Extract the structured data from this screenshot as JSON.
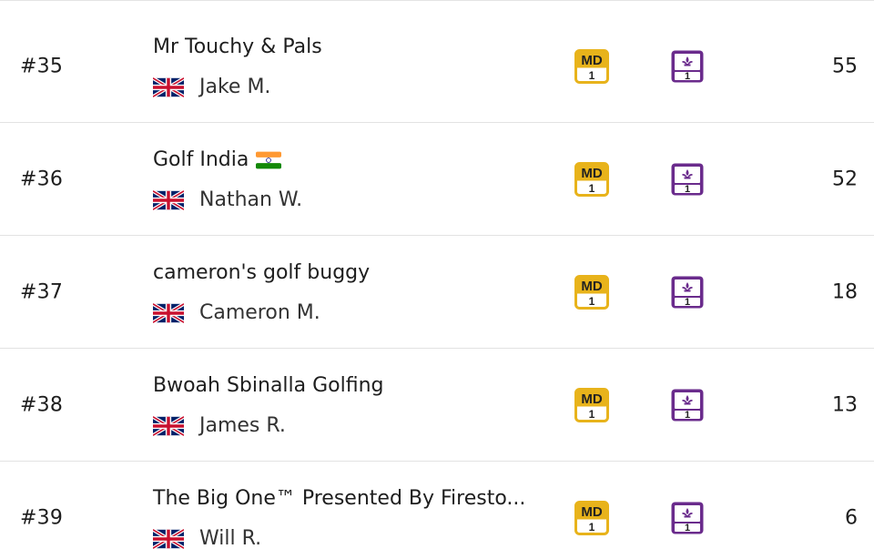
{
  "colors": {
    "md_chip": "#e8b31b",
    "gw_chip": "#6a2b8c",
    "divider": "#e2e2e2",
    "text": "#1e1e1e"
  },
  "chips": {
    "md": {
      "code": "MD",
      "number": "1"
    },
    "gw": {
      "icon": "fleur-de-lis-icon",
      "number": "1"
    }
  },
  "entries": [
    {
      "rank": "#35",
      "team": "Mr Touchy & Pals",
      "flag": "uk-flag-icon",
      "manager": "Jake M.",
      "points": "55"
    },
    {
      "rank": "#36",
      "team": "Golf India",
      "team_flag": "india-flag-icon",
      "flag": "uk-flag-icon",
      "manager": "Nathan W.",
      "points": "52"
    },
    {
      "rank": "#37",
      "team": "cameron's golf buggy",
      "flag": "uk-flag-icon",
      "manager": "Cameron M.",
      "points": "18"
    },
    {
      "rank": "#38",
      "team": "Bwoah Sbinalla Golfing",
      "flag": "uk-flag-icon",
      "manager": "James R.",
      "points": "13"
    },
    {
      "rank": "#39",
      "team": "The Big One™ Presented By Firesto...",
      "flag": "uk-flag-icon",
      "manager": "Will R.",
      "points": "6"
    }
  ]
}
